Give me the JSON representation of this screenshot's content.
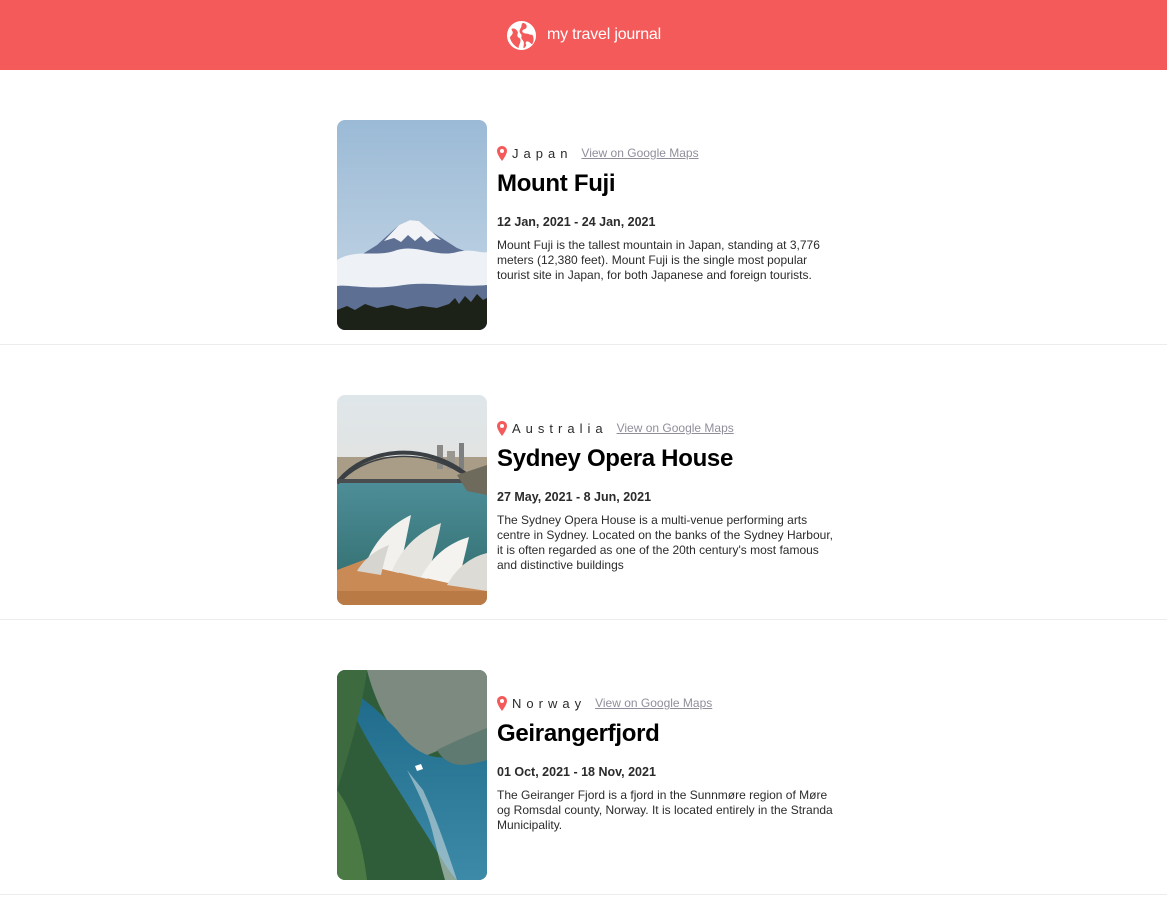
{
  "header": {
    "title": "my travel journal",
    "icon": "globe-icon",
    "color": "#F55A5A"
  },
  "entries": [
    {
      "country": "Japan",
      "maps_link": "View on Google Maps",
      "title": "Mount Fuji",
      "dates": "12 Jan, 2021 - 24 Jan, 2021",
      "description": "Mount Fuji is the tallest mountain in Japan, standing at 3,776 meters (12,380 feet). Mount Fuji is the single most popular tourist site in Japan, for both Japanese and foreign tourists."
    },
    {
      "country": "Australia",
      "maps_link": "View on Google Maps",
      "title": "Sydney Opera House",
      "dates": "27 May, 2021 - 8 Jun, 2021",
      "description": "The Sydney Opera House is a multi-venue performing arts centre in Sydney. Located on the banks of the Sydney Harbour, it is often regarded as one of the 20th century's most famous and distinctive buildings"
    },
    {
      "country": "Norway",
      "maps_link": "View on Google Maps",
      "title": "Geirangerfjord",
      "dates": "01 Oct, 2021 - 18 Nov, 2021",
      "description": "The Geiranger Fjord is a fjord in the Sunnmøre region of Møre og Romsdal county, Norway. It is located entirely in the Stranda Municipality."
    }
  ]
}
